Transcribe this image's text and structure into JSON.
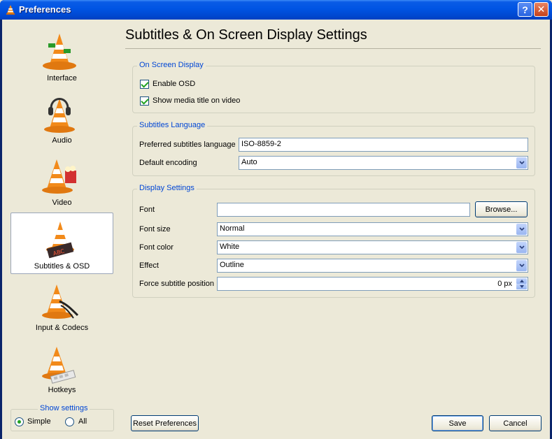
{
  "window": {
    "title": "Preferences",
    "help_glyph": "?",
    "close_glyph": "✕"
  },
  "sidebar": {
    "items": [
      {
        "label": "Interface"
      },
      {
        "label": "Audio"
      },
      {
        "label": "Video"
      },
      {
        "label": "Subtitles & OSD",
        "selected": true
      },
      {
        "label": "Input & Codecs"
      },
      {
        "label": "Hotkeys"
      }
    ],
    "show_settings": {
      "legend": "Show settings",
      "simple_label": "Simple",
      "all_label": "All",
      "selected": "Simple"
    }
  },
  "main": {
    "title": "Subtitles & On Screen Display Settings",
    "osd": {
      "legend": "On Screen Display",
      "enable_osd": {
        "label": "Enable OSD",
        "checked": true
      },
      "show_title": {
        "label": "Show media title on video",
        "checked": true
      }
    },
    "subtitles_language": {
      "legend": "Subtitles Language",
      "preferred_label": "Preferred subtitles language",
      "preferred_value": "ISO-8859-2",
      "encoding_label": "Default encoding",
      "encoding_value": "Auto"
    },
    "display": {
      "legend": "Display Settings",
      "font_label": "Font",
      "font_value": "",
      "browse_label": "Browse...",
      "font_size_label": "Font size",
      "font_size_value": "Normal",
      "font_color_label": "Font color",
      "font_color_value": "White",
      "effect_label": "Effect",
      "effect_value": "Outline",
      "position_label": "Force subtitle position",
      "position_value": "0 px"
    }
  },
  "footer": {
    "reset_label": "Reset Preferences",
    "save_label": "Save",
    "cancel_label": "Cancel"
  },
  "colors": {
    "titlebar": "#0054e3",
    "legend_blue": "#0046d5",
    "check_green": "#21a121",
    "cone_orange": "#f28a1a"
  }
}
